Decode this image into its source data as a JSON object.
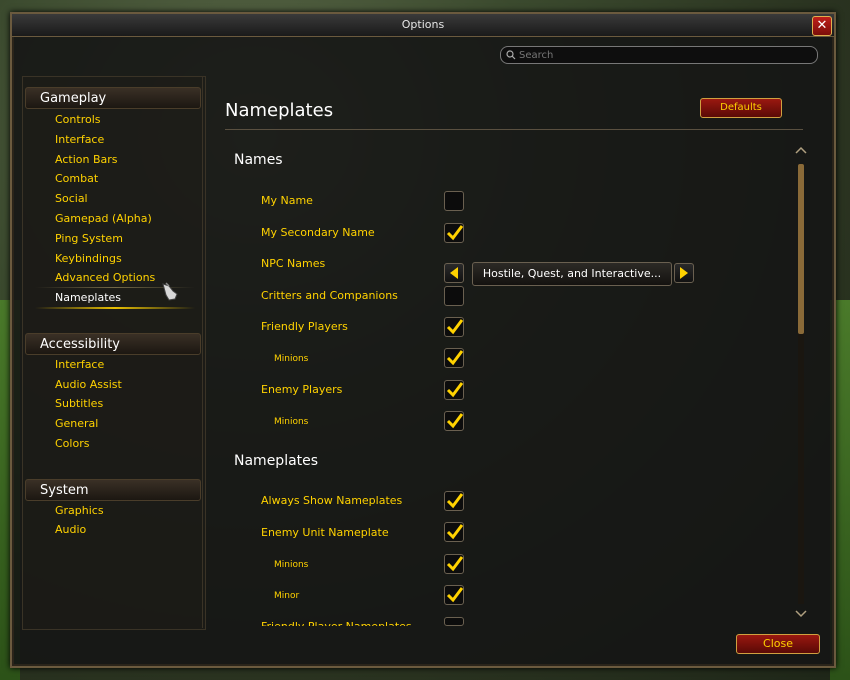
{
  "window": {
    "title": "Options"
  },
  "search": {
    "placeholder": "Search"
  },
  "sidebar": {
    "categories": [
      {
        "label": "Gameplay",
        "items": [
          "Controls",
          "Interface",
          "Action Bars",
          "Combat",
          "Social",
          "Gamepad (Alpha)",
          "Ping System",
          "Keybindings",
          "Advanced Options",
          "Nameplates"
        ]
      },
      {
        "label": "Accessibility",
        "items": [
          "Interface",
          "Audio Assist",
          "Subtitles",
          "General",
          "Colors"
        ]
      },
      {
        "label": "System",
        "items": [
          "Graphics",
          "Audio"
        ]
      }
    ],
    "selected": "Nameplates"
  },
  "main": {
    "title": "Nameplates",
    "defaults_label": "Defaults",
    "sections": {
      "names": {
        "heading": "Names",
        "options": [
          {
            "label": "My Name",
            "checked": false
          },
          {
            "label": "My Secondary Name",
            "checked": true
          },
          {
            "label": "NPC Names",
            "value": "Hostile, Quest, and Interactive..."
          },
          {
            "label": "Critters and Companions",
            "checked": false
          },
          {
            "label": "Friendly Players",
            "checked": true
          },
          {
            "label": "Minions",
            "checked": true
          },
          {
            "label": "Enemy Players",
            "checked": true
          },
          {
            "label": "Minions",
            "checked": true
          }
        ]
      },
      "nameplates": {
        "heading": "Nameplates",
        "options": [
          {
            "label": "Always Show Nameplates",
            "checked": true
          },
          {
            "label": "Enemy Unit Nameplate",
            "checked": true
          },
          {
            "label": "Minions",
            "checked": true
          },
          {
            "label": "Minor",
            "checked": true
          },
          {
            "label": "Friendly Player Nameplates",
            "checked": false
          }
        ]
      }
    }
  },
  "footer": {
    "close_label": "Close"
  },
  "colors": {
    "accent_gold": "#ffd200",
    "button_red": "#9a1810"
  }
}
